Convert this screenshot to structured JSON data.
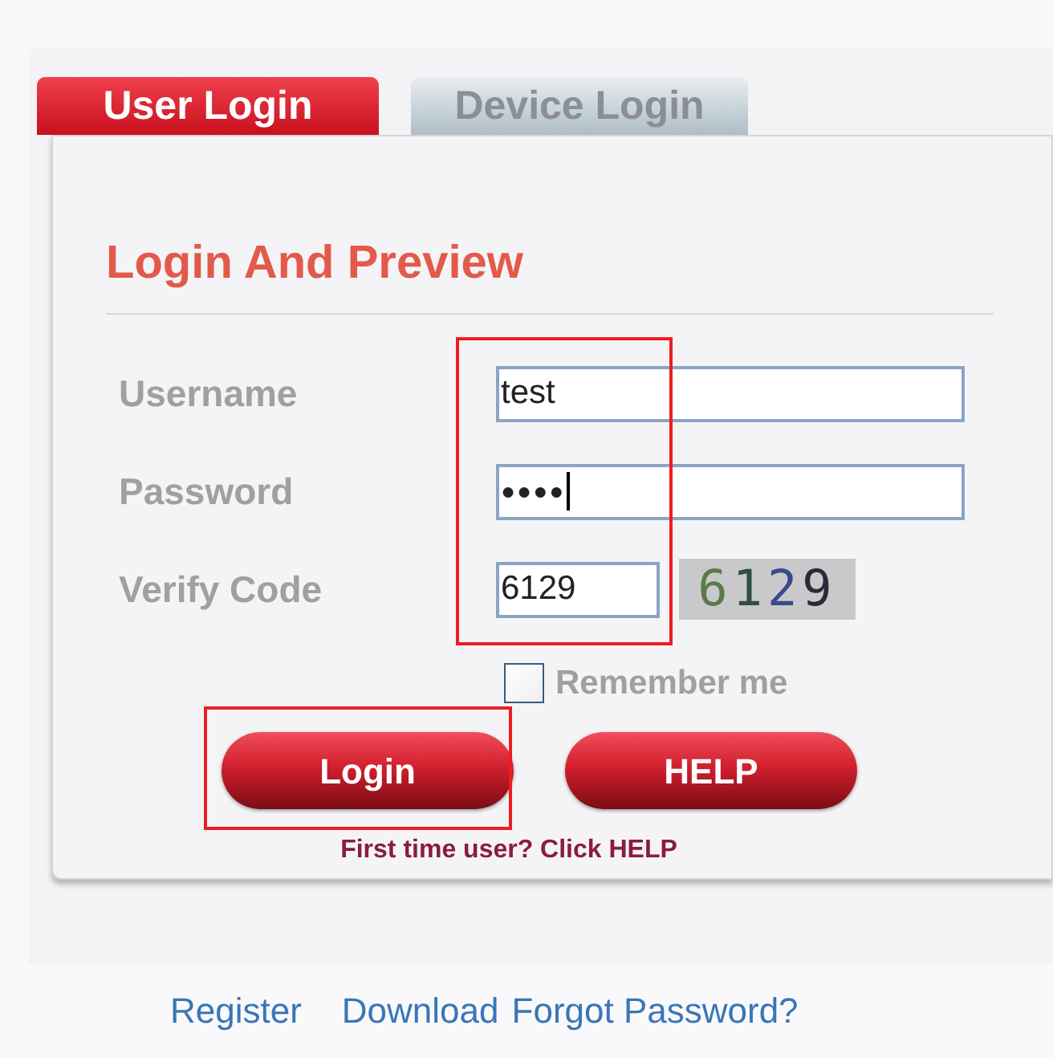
{
  "tabs": [
    {
      "label": "User Login",
      "selected": true
    },
    {
      "label": "Device Login",
      "selected": false
    }
  ],
  "panel": {
    "title": "Login And Preview",
    "fields": [
      {
        "label": "Username",
        "value": "test",
        "kind": "text"
      },
      {
        "label": "Password",
        "value": "●●●●",
        "kind": "password"
      },
      {
        "label": "Verify Code",
        "value": "6129",
        "kind": "captcha",
        "captcha": "6129"
      }
    ],
    "remember": {
      "label": "Remember me",
      "checked": false
    },
    "buttons": [
      "Login",
      "HELP"
    ],
    "hint": "First time user? Click HELP"
  },
  "footer_links": [
    "Register",
    "Download",
    "Forgot Password?"
  ]
}
